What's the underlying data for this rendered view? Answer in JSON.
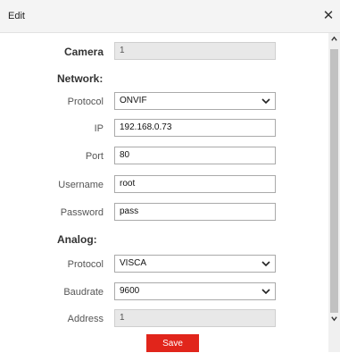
{
  "dialog": {
    "title": "Edit",
    "close_icon": "close-icon"
  },
  "camera": {
    "label": "Camera",
    "value": "1"
  },
  "network": {
    "heading": "Network:",
    "protocol": {
      "label": "Protocol",
      "value": "ONVIF"
    },
    "ip": {
      "label": "IP",
      "value": "192.168.0.73"
    },
    "port": {
      "label": "Port",
      "value": "80"
    },
    "username": {
      "label": "Username",
      "value": "root"
    },
    "password": {
      "label": "Password",
      "value": "pass"
    }
  },
  "analog": {
    "heading": "Analog:",
    "protocol": {
      "label": "Protocol",
      "value": "VISCA"
    },
    "baudrate": {
      "label": "Baudrate",
      "value": "9600"
    },
    "address": {
      "label": "Address",
      "value": "1"
    }
  },
  "actions": {
    "save_label": "Save",
    "save_color": "#e1251b"
  }
}
